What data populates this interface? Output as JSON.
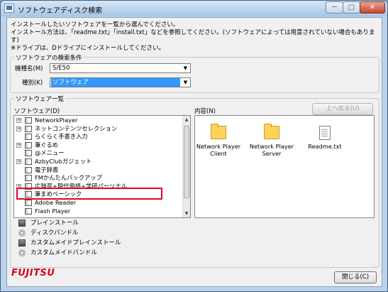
{
  "window": {
    "title": "ソフトウェアディスク検索",
    "buttons": {
      "minimize": "─",
      "maximize": "□",
      "close": "✕"
    }
  },
  "info_lines": [
    "インストールしたいソフトウェアを一覧から選んでください。",
    "インストール方法は、「readme.txt」「install.txt」などを参照してください。(ソフトウェアによっては用意されていない場合もあります)",
    "※ドライブは、Dドライブにインストールしてください。"
  ],
  "search": {
    "group_title": "ソフトウェアの検索条件",
    "model_label": "機種名(M)",
    "model_value": "S/E50",
    "type_label": "種別(K)",
    "type_value": "ソフトウェア"
  },
  "list_section": {
    "group_title": "ソフトウェア一覧",
    "software_label": "ソフトウェア(D)",
    "content_label": "内容(N)",
    "up_button": "上へ戻る(U)"
  },
  "tree_items": [
    {
      "label": "NetworkPlayer",
      "expandable": true
    },
    {
      "label": "ネットコンテンツセレクション",
      "expandable": true
    },
    {
      "label": "らくらく手書き入力",
      "expandable": false
    },
    {
      "label": "筆ぐるめ",
      "expandable": true
    },
    {
      "label": "@メニュー",
      "expandable": false
    },
    {
      "label": "AzbyClubガジェット",
      "expandable": true
    },
    {
      "label": "電子辞書",
      "expandable": false
    },
    {
      "label": "FMかんたんバックアップ",
      "expandable": false
    },
    {
      "label": "広辞苑+現代用語+学研パーソナル",
      "expandable": true
    },
    {
      "label": "筆まめベーシック",
      "expandable": false
    },
    {
      "label": "Adobe Reader",
      "expandable": false
    },
    {
      "label": "Flash Player",
      "expandable": false
    }
  ],
  "content_items": [
    {
      "type": "folder",
      "label_lines": [
        "Network Player",
        "Client"
      ]
    },
    {
      "type": "folder",
      "label_lines": [
        "Network Player",
        "Server"
      ]
    },
    {
      "type": "document",
      "label_lines": [
        "Readme.txt",
        ""
      ]
    }
  ],
  "install_options": [
    {
      "label": "プレインストール",
      "icon": "pc-icon"
    },
    {
      "label": "ディスクバンドル",
      "icon": "disc-icon"
    },
    {
      "label": "カスタムメイドプレインストール",
      "icon": "pc-icon"
    },
    {
      "label": "カスタムメイドバンドル",
      "icon": "disc-icon"
    }
  ],
  "logo": "FUJITSU",
  "close_button": "閉じる(C)",
  "colors": {
    "accent": "#3399ff",
    "highlight_box": "#e8002a",
    "logo": "#d9001b"
  }
}
